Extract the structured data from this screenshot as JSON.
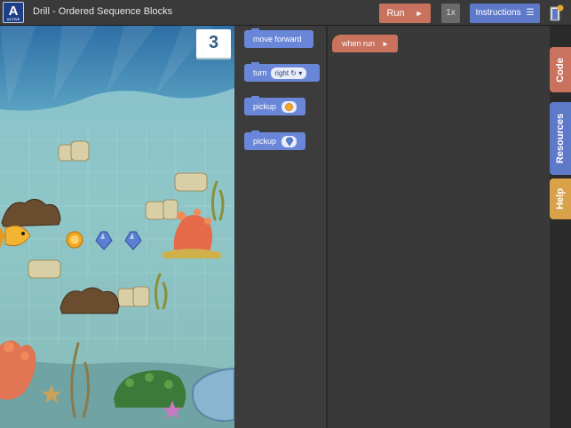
{
  "app": {
    "title": "Drill - Ordered Sequence Blocks",
    "logo_letter": "A",
    "logo_subtext": "ACTIVE"
  },
  "toolbar": {
    "run_label": "Run",
    "run_icon": "play-arrow-icon",
    "speed_label": "1x",
    "instructions_label": "Instructions",
    "instructions_icon": "menu-icon",
    "exit_icon": "exit-door-icon"
  },
  "game": {
    "counter_value": "3"
  },
  "palette": {
    "blocks": [
      {
        "label": "move forward"
      },
      {
        "label": "turn",
        "option": "right ↻",
        "option_caret": "▾"
      },
      {
        "label": "pickup",
        "item_icon": "coin-icon"
      },
      {
        "label": "pickup",
        "item_icon": "gem-icon"
      }
    ]
  },
  "workspace": {
    "event_block": {
      "label": "when run",
      "icon": "play-arrow-icon"
    }
  },
  "tabs": {
    "code": "Code",
    "resources": "Resources",
    "help": "Help"
  },
  "colors": {
    "run_button": "#c9735f",
    "motion_block": "#6a86d8",
    "instructions_button": "#5f79c9",
    "help_tab": "#d9a14a"
  }
}
